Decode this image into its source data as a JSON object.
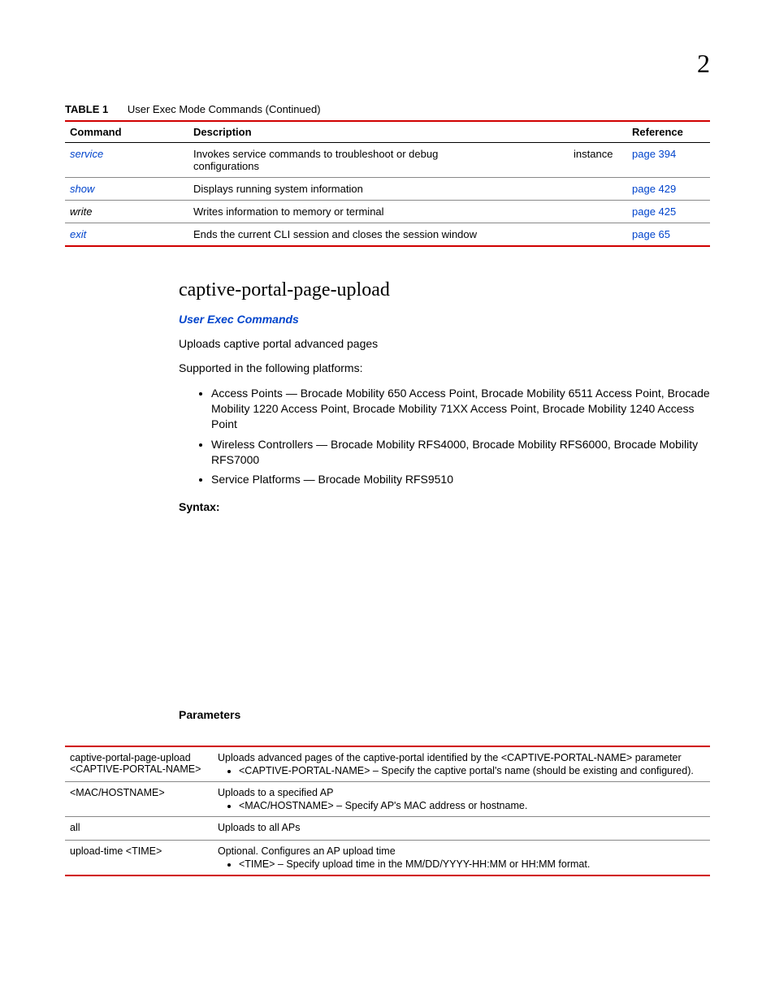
{
  "chapterNumber": "2",
  "table1": {
    "label": "TABLE 1",
    "caption": "User Exec Mode Commands (Continued)",
    "headers": {
      "c1": "Command",
      "c2": "Description",
      "c3": "Reference"
    },
    "rows": [
      {
        "cmd": "service",
        "cmdLink": true,
        "desc": "Invokes service commands to troubleshoot or debug",
        "desc2": "configurations",
        "extra": "instance",
        "ref": "page 394"
      },
      {
        "cmd": "show",
        "cmdLink": true,
        "desc": "Displays running system information",
        "ref": "page 429"
      },
      {
        "cmd": "write",
        "cmdLink": false,
        "desc": "Writes information to memory or terminal",
        "ref": "page 425"
      },
      {
        "cmd": "exit",
        "cmdLink": true,
        "desc": "Ends the current CLI session and closes the session window",
        "ref": "page 65"
      }
    ]
  },
  "section": {
    "heading": "captive-portal-page-upload",
    "subsectionLink": "User Exec Commands",
    "intro": "Uploads captive portal advanced pages",
    "supported": "Supported in the following platforms:",
    "platforms": [
      "Access Points — Brocade Mobility 650 Access Point, Brocade Mobility 6511 Access Point, Brocade Mobility 1220 Access Point, Brocade Mobility 71XX Access Point, Brocade Mobility 1240 Access Point",
      "Wireless Controllers — Brocade Mobility RFS4000, Brocade Mobility RFS6000, Brocade Mobility RFS7000",
      "Service Platforms — Brocade Mobility RFS9510"
    ],
    "syntaxLabel": "Syntax:",
    "paramsLabel": "Parameters"
  },
  "paramsTable": {
    "rows": [
      {
        "name": "captive-portal-page-upload <CAPTIVE-PORTAL-NAME>",
        "desc": "Uploads advanced pages of the captive-portal identified by the <CAPTIVE-PORTAL-NAME> parameter",
        "bullet": "<CAPTIVE-PORTAL-NAME> – Specify the captive portal's name (should be existing and configured)."
      },
      {
        "name": "<MAC/HOSTNAME>",
        "desc": "Uploads to a specified AP",
        "bullet": "<MAC/HOSTNAME> – Specify AP's MAC address or hostname."
      },
      {
        "name": "all",
        "desc": "Uploads to all APs",
        "bullet": ""
      },
      {
        "name": "upload-time <TIME>",
        "desc": "Optional. Configures an AP upload time",
        "bullet": "<TIME> – Specify upload time in the MM/DD/YYYY-HH:MM or HH:MM format."
      }
    ]
  }
}
